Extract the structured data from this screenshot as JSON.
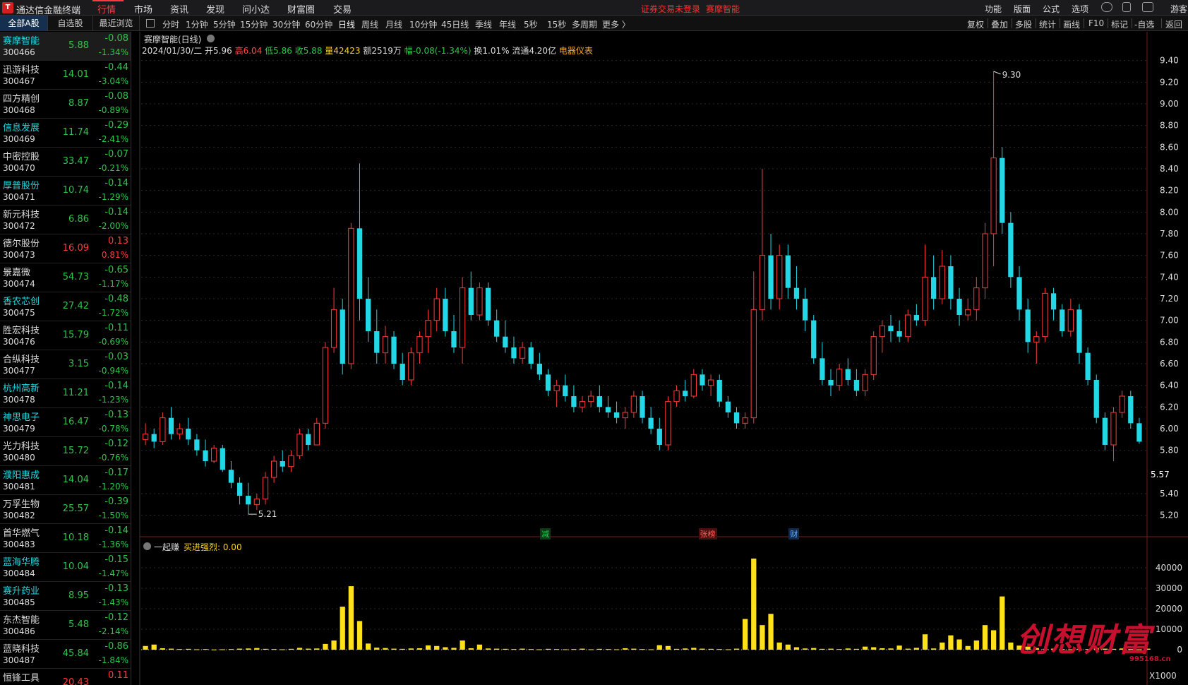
{
  "app": {
    "title": "通达信金融终端",
    "logo": "tdx-logo-icon"
  },
  "menu": [
    "行情",
    "市场",
    "资讯",
    "发现",
    "问小达",
    "财富圈",
    "交易"
  ],
  "menu_active": "行情",
  "login": {
    "warning": "证券交易未登录",
    "stock": "赛摩智能"
  },
  "tools": [
    "功能",
    "版面",
    "公式",
    "选项"
  ],
  "user": "游客",
  "side_tabs": [
    "全部A股",
    "自选股",
    "最近浏览"
  ],
  "periods": [
    "分时",
    "1分钟",
    "5分钟",
    "15分钟",
    "30分钟",
    "60分钟",
    "日线",
    "周线",
    "月线",
    "10分钟",
    "45日线",
    "季线",
    "年线",
    "5秒",
    "15秒",
    "多周期",
    "更多 〉"
  ],
  "period_active": "日线",
  "right_tools": [
    "复权",
    "叠加",
    "多股",
    "统计",
    "画线",
    "F10",
    "标记",
    "-自选",
    "返回"
  ],
  "stocks": [
    {
      "name": "赛摩智能",
      "code": "300466",
      "price": "5.88",
      "chg": "-0.08",
      "pct": "-1.34%",
      "cyan": true
    },
    {
      "name": "迅游科技",
      "code": "300467",
      "price": "14.01",
      "chg": "-0.44",
      "pct": "-3.04%",
      "cyan": false
    },
    {
      "name": "四方精创",
      "code": "300468",
      "price": "8.87",
      "chg": "-0.08",
      "pct": "-0.89%",
      "cyan": false
    },
    {
      "name": "信息发展",
      "code": "300469",
      "price": "11.74",
      "chg": "-0.29",
      "pct": "-2.41%",
      "cyan": true
    },
    {
      "name": "中密控股",
      "code": "300470",
      "price": "33.47",
      "chg": "-0.07",
      "pct": "-0.21%",
      "cyan": false
    },
    {
      "name": "厚普股份",
      "code": "300471",
      "price": "10.74",
      "chg": "-0.14",
      "pct": "-1.29%",
      "cyan": true
    },
    {
      "name": "新元科技",
      "code": "300472",
      "price": "6.86",
      "chg": "-0.14",
      "pct": "-2.00%",
      "cyan": false
    },
    {
      "name": "德尔股份",
      "code": "300473",
      "price": "16.09",
      "chg": "0.13",
      "pct": "0.81%",
      "cyan": false
    },
    {
      "name": "景嘉微",
      "code": "300474",
      "price": "54.73",
      "chg": "-0.65",
      "pct": "-1.17%",
      "cyan": false
    },
    {
      "name": "香农芯创",
      "code": "300475",
      "price": "27.42",
      "chg": "-0.48",
      "pct": "-1.72%",
      "cyan": true
    },
    {
      "name": "胜宏科技",
      "code": "300476",
      "price": "15.79",
      "chg": "-0.11",
      "pct": "-0.69%",
      "cyan": false
    },
    {
      "name": "合纵科技",
      "code": "300477",
      "price": "3.15",
      "chg": "-0.03",
      "pct": "-0.94%",
      "cyan": false
    },
    {
      "name": "杭州高新",
      "code": "300478",
      "price": "11.21",
      "chg": "-0.14",
      "pct": "-1.23%",
      "cyan": true
    },
    {
      "name": "神思电子",
      "code": "300479",
      "price": "16.47",
      "chg": "-0.13",
      "pct": "-0.78%",
      "cyan": true
    },
    {
      "name": "光力科技",
      "code": "300480",
      "price": "15.72",
      "chg": "-0.12",
      "pct": "-0.76%",
      "cyan": false
    },
    {
      "name": "濮阳惠成",
      "code": "300481",
      "price": "14.04",
      "chg": "-0.17",
      "pct": "-1.20%",
      "cyan": true
    },
    {
      "name": "万孚生物",
      "code": "300482",
      "price": "25.57",
      "chg": "-0.39",
      "pct": "-1.50%",
      "cyan": false
    },
    {
      "name": "首华燃气",
      "code": "300483",
      "price": "10.18",
      "chg": "-0.14",
      "pct": "-1.36%",
      "cyan": false
    },
    {
      "name": "蓝海华腾",
      "code": "300484",
      "price": "10.04",
      "chg": "-0.15",
      "pct": "-1.47%",
      "cyan": true
    },
    {
      "name": "赛升药业",
      "code": "300485",
      "price": "8.95",
      "chg": "-0.13",
      "pct": "-1.43%",
      "cyan": true
    },
    {
      "name": "东杰智能",
      "code": "300486",
      "price": "5.48",
      "chg": "-0.12",
      "pct": "-2.14%",
      "cyan": false
    },
    {
      "name": "蓝晓科技",
      "code": "300487",
      "price": "45.84",
      "chg": "-0.86",
      "pct": "-1.84%",
      "cyan": false
    },
    {
      "name": "恒锋工具",
      "code": "",
      "price": "20.43",
      "chg": "0.11",
      "pct": "",
      "cyan": false
    }
  ],
  "chart": {
    "title": "赛摩智能(日线)",
    "info": {
      "date": "2024/01/30/二",
      "open": "开5.96",
      "high": "高6.04",
      "low": "低5.86",
      "close": "收5.88",
      "vol": "量42423",
      "amount": "额2519万",
      "range": "幅-0.08(-1.34%)",
      "turnover": "换1.01%",
      "float": "流通4.20亿",
      "sector": "电器仪表"
    },
    "current_price_tag": "5.57",
    "vol_title": "一起赚",
    "vol_indicator": "买进强烈: 0.00",
    "vol_unit": "X1000",
    "events": [
      {
        "label": "减",
        "color": "#2cc74a",
        "bg": "#0f3a18",
        "pos": 0.398
      },
      {
        "label": "张榜",
        "color": "#ff6060",
        "bg": "#4a1010",
        "pos": 0.556
      },
      {
        "label": "财",
        "color": "#6fb0ff",
        "bg": "#0f2a4a",
        "pos": 0.646
      }
    ]
  },
  "chart_data": {
    "type": "candlestick",
    "title": "赛摩智能(日线)",
    "price_axis": {
      "ylim": [
        5.1,
        9.45
      ],
      "ticks": [
        5.2,
        5.4,
        5.8,
        6.0,
        6.2,
        6.4,
        6.6,
        6.8,
        7.0,
        7.2,
        7.4,
        7.6,
        7.8,
        8.0,
        8.2,
        8.4,
        8.6,
        8.8,
        9.0,
        9.2,
        9.4
      ]
    },
    "annotations": [
      {
        "label": "9.30",
        "value": 9.3
      },
      {
        "label": "5.21",
        "value": 5.21
      }
    ],
    "volume_axis": {
      "ylim": [
        0,
        50000
      ],
      "ticks": [
        0,
        10000,
        20000,
        30000,
        40000
      ],
      "unit": "X1000"
    },
    "ohlc": [
      [
        5.9,
        6.05,
        5.85,
        5.95
      ],
      [
        5.95,
        6.0,
        5.82,
        5.88
      ],
      [
        5.88,
        6.15,
        5.85,
        6.1
      ],
      [
        6.1,
        6.2,
        5.9,
        5.95
      ],
      [
        5.95,
        6.05,
        5.9,
        6.0
      ],
      [
        6.0,
        6.1,
        5.85,
        5.9
      ],
      [
        5.9,
        5.95,
        5.75,
        5.8
      ],
      [
        5.8,
        5.9,
        5.65,
        5.7
      ],
      [
        5.7,
        5.85,
        5.68,
        5.82
      ],
      [
        5.82,
        5.85,
        5.6,
        5.62
      ],
      [
        5.62,
        5.7,
        5.45,
        5.5
      ],
      [
        5.5,
        5.55,
        5.3,
        5.38
      ],
      [
        5.38,
        5.5,
        5.21,
        5.3
      ],
      [
        5.3,
        5.4,
        5.25,
        5.35
      ],
      [
        5.35,
        5.6,
        5.3,
        5.55
      ],
      [
        5.55,
        5.75,
        5.5,
        5.7
      ],
      [
        5.7,
        5.8,
        5.6,
        5.65
      ],
      [
        5.65,
        5.8,
        5.6,
        5.75
      ],
      [
        5.75,
        6.0,
        5.72,
        5.95
      ],
      [
        5.95,
        6.0,
        5.8,
        5.85
      ],
      [
        5.85,
        6.1,
        5.85,
        6.05
      ],
      [
        6.05,
        6.8,
        6.0,
        6.75
      ],
      [
        6.75,
        7.3,
        6.7,
        7.1
      ],
      [
        7.1,
        7.2,
        6.5,
        6.6
      ],
      [
        6.6,
        7.9,
        6.55,
        7.85
      ],
      [
        7.85,
        8.45,
        7.0,
        7.2
      ],
      [
        7.2,
        7.4,
        6.8,
        6.9
      ],
      [
        6.9,
        7.1,
        6.6,
        6.7
      ],
      [
        6.7,
        6.95,
        6.6,
        6.85
      ],
      [
        6.85,
        6.9,
        6.55,
        6.6
      ],
      [
        6.6,
        6.7,
        6.4,
        6.45
      ],
      [
        6.45,
        6.75,
        6.4,
        6.7
      ],
      [
        6.7,
        6.9,
        6.6,
        6.85
      ],
      [
        6.85,
        7.1,
        6.7,
        7.0
      ],
      [
        7.0,
        7.3,
        6.9,
        7.2
      ],
      [
        7.2,
        7.3,
        6.85,
        6.9
      ],
      [
        6.9,
        7.05,
        6.7,
        6.75
      ],
      [
        6.75,
        7.4,
        6.6,
        7.3
      ],
      [
        7.3,
        7.45,
        7.0,
        7.05
      ],
      [
        7.05,
        7.35,
        7.0,
        7.3
      ],
      [
        7.3,
        7.35,
        6.95,
        7.0
      ],
      [
        7.0,
        7.1,
        6.8,
        6.85
      ],
      [
        6.85,
        7.0,
        6.7,
        6.75
      ],
      [
        6.75,
        6.85,
        6.6,
        6.65
      ],
      [
        6.65,
        6.8,
        6.6,
        6.75
      ],
      [
        6.75,
        6.8,
        6.55,
        6.6
      ],
      [
        6.6,
        6.7,
        6.45,
        6.5
      ],
      [
        6.5,
        6.55,
        6.3,
        6.35
      ],
      [
        6.35,
        6.45,
        6.2,
        6.4
      ],
      [
        6.4,
        6.5,
        6.25,
        6.3
      ],
      [
        6.3,
        6.4,
        6.15,
        6.2
      ],
      [
        6.2,
        6.3,
        6.15,
        6.25
      ],
      [
        6.25,
        6.35,
        6.2,
        6.3
      ],
      [
        6.3,
        6.4,
        6.15,
        6.2
      ],
      [
        6.2,
        6.3,
        6.1,
        6.15
      ],
      [
        6.15,
        6.25,
        6.05,
        6.1
      ],
      [
        6.1,
        6.2,
        6.0,
        6.15
      ],
      [
        6.15,
        6.35,
        6.1,
        6.3
      ],
      [
        6.3,
        6.35,
        6.05,
        6.1
      ],
      [
        6.1,
        6.2,
        5.95,
        6.0
      ],
      [
        6.0,
        6.1,
        5.8,
        5.85
      ],
      [
        5.85,
        6.3,
        5.8,
        6.25
      ],
      [
        6.25,
        6.4,
        6.2,
        6.35
      ],
      [
        6.35,
        6.45,
        6.25,
        6.3
      ],
      [
        6.3,
        6.55,
        6.28,
        6.5
      ],
      [
        6.5,
        6.55,
        6.35,
        6.4
      ],
      [
        6.4,
        6.5,
        6.3,
        6.45
      ],
      [
        6.45,
        6.5,
        6.2,
        6.25
      ],
      [
        6.25,
        6.3,
        6.1,
        6.15
      ],
      [
        6.15,
        6.2,
        6.0,
        6.05
      ],
      [
        6.05,
        6.15,
        6.0,
        6.1
      ],
      [
        6.1,
        7.45,
        6.05,
        7.1
      ],
      [
        7.1,
        8.4,
        7.0,
        7.6
      ],
      [
        7.6,
        7.8,
        7.1,
        7.2
      ],
      [
        7.2,
        7.7,
        7.1,
        7.6
      ],
      [
        7.6,
        7.7,
        7.2,
        7.3
      ],
      [
        7.3,
        7.5,
        7.1,
        7.2
      ],
      [
        7.2,
        7.3,
        6.9,
        7.0
      ],
      [
        7.0,
        7.05,
        6.6,
        6.65
      ],
      [
        6.65,
        6.8,
        6.4,
        6.45
      ],
      [
        6.45,
        6.55,
        6.3,
        6.4
      ],
      [
        6.4,
        6.6,
        6.35,
        6.55
      ],
      [
        6.55,
        6.65,
        6.4,
        6.45
      ],
      [
        6.45,
        6.55,
        6.3,
        6.35
      ],
      [
        6.35,
        6.55,
        6.3,
        6.5
      ],
      [
        6.5,
        6.9,
        6.45,
        6.85
      ],
      [
        6.85,
        7.0,
        6.7,
        6.95
      ],
      [
        6.95,
        7.05,
        6.8,
        6.9
      ],
      [
        6.9,
        7.0,
        6.8,
        6.85
      ],
      [
        6.85,
        7.1,
        6.8,
        7.05
      ],
      [
        7.05,
        7.15,
        6.95,
        7.0
      ],
      [
        7.0,
        7.7,
        6.95,
        7.4
      ],
      [
        7.4,
        7.6,
        7.1,
        7.2
      ],
      [
        7.2,
        7.65,
        7.15,
        7.5
      ],
      [
        7.5,
        7.6,
        7.1,
        7.2
      ],
      [
        7.2,
        7.3,
        6.95,
        7.05
      ],
      [
        7.05,
        7.2,
        7.0,
        7.1
      ],
      [
        7.1,
        7.4,
        7.0,
        7.3
      ],
      [
        7.3,
        7.9,
        7.2,
        7.8
      ],
      [
        7.8,
        9.3,
        7.5,
        8.5
      ],
      [
        8.5,
        8.6,
        7.8,
        7.9
      ],
      [
        7.9,
        8.0,
        7.3,
        7.4
      ],
      [
        7.4,
        7.5,
        7.0,
        7.1
      ],
      [
        7.1,
        7.2,
        6.7,
        6.8
      ],
      [
        6.8,
        6.9,
        6.6,
        6.85
      ],
      [
        6.85,
        7.3,
        6.8,
        7.25
      ],
      [
        7.25,
        7.3,
        7.0,
        7.1
      ],
      [
        7.1,
        7.15,
        6.85,
        6.9
      ],
      [
        6.9,
        7.2,
        6.85,
        7.1
      ],
      [
        7.1,
        7.15,
        6.6,
        6.7
      ],
      [
        6.7,
        6.75,
        6.4,
        6.45
      ],
      [
        6.45,
        6.5,
        6.05,
        6.1
      ],
      [
        6.1,
        6.15,
        5.8,
        5.85
      ],
      [
        5.85,
        6.2,
        5.7,
        6.15
      ],
      [
        6.15,
        6.35,
        6.1,
        6.3
      ],
      [
        6.3,
        6.35,
        6.0,
        6.05
      ],
      [
        6.05,
        6.1,
        5.86,
        5.88
      ]
    ],
    "volume": [
      1800,
      2500,
      700,
      500,
      300,
      400,
      200,
      300,
      100,
      200,
      300,
      500,
      600,
      800,
      400,
      300,
      200,
      400,
      900,
      500,
      600,
      2800,
      4500,
      21000,
      31000,
      14000,
      3000,
      1000,
      800,
      500,
      400,
      600,
      700,
      2100,
      1800,
      1200,
      900,
      4500,
      700,
      2500,
      600,
      500,
      400,
      300,
      500,
      300,
      200,
      400,
      300,
      200,
      300,
      500,
      200,
      400,
      300,
      200,
      700,
      500,
      300,
      200,
      2200,
      1800,
      400,
      600,
      900,
      500,
      400,
      300,
      200,
      500,
      15000,
      44500,
      12000,
      17500,
      3500,
      2500,
      1200,
      600,
      800,
      400,
      500,
      300,
      600,
      400,
      1500,
      1200,
      700,
      600,
      2000,
      500,
      900,
      7500,
      600,
      3500,
      7000,
      5000,
      1800,
      4500,
      12000,
      9500,
      26000,
      3500,
      2000,
      1500,
      800,
      400,
      500,
      300,
      200,
      400,
      300,
      800,
      500,
      400,
      600,
      300,
      200,
      500
    ]
  }
}
